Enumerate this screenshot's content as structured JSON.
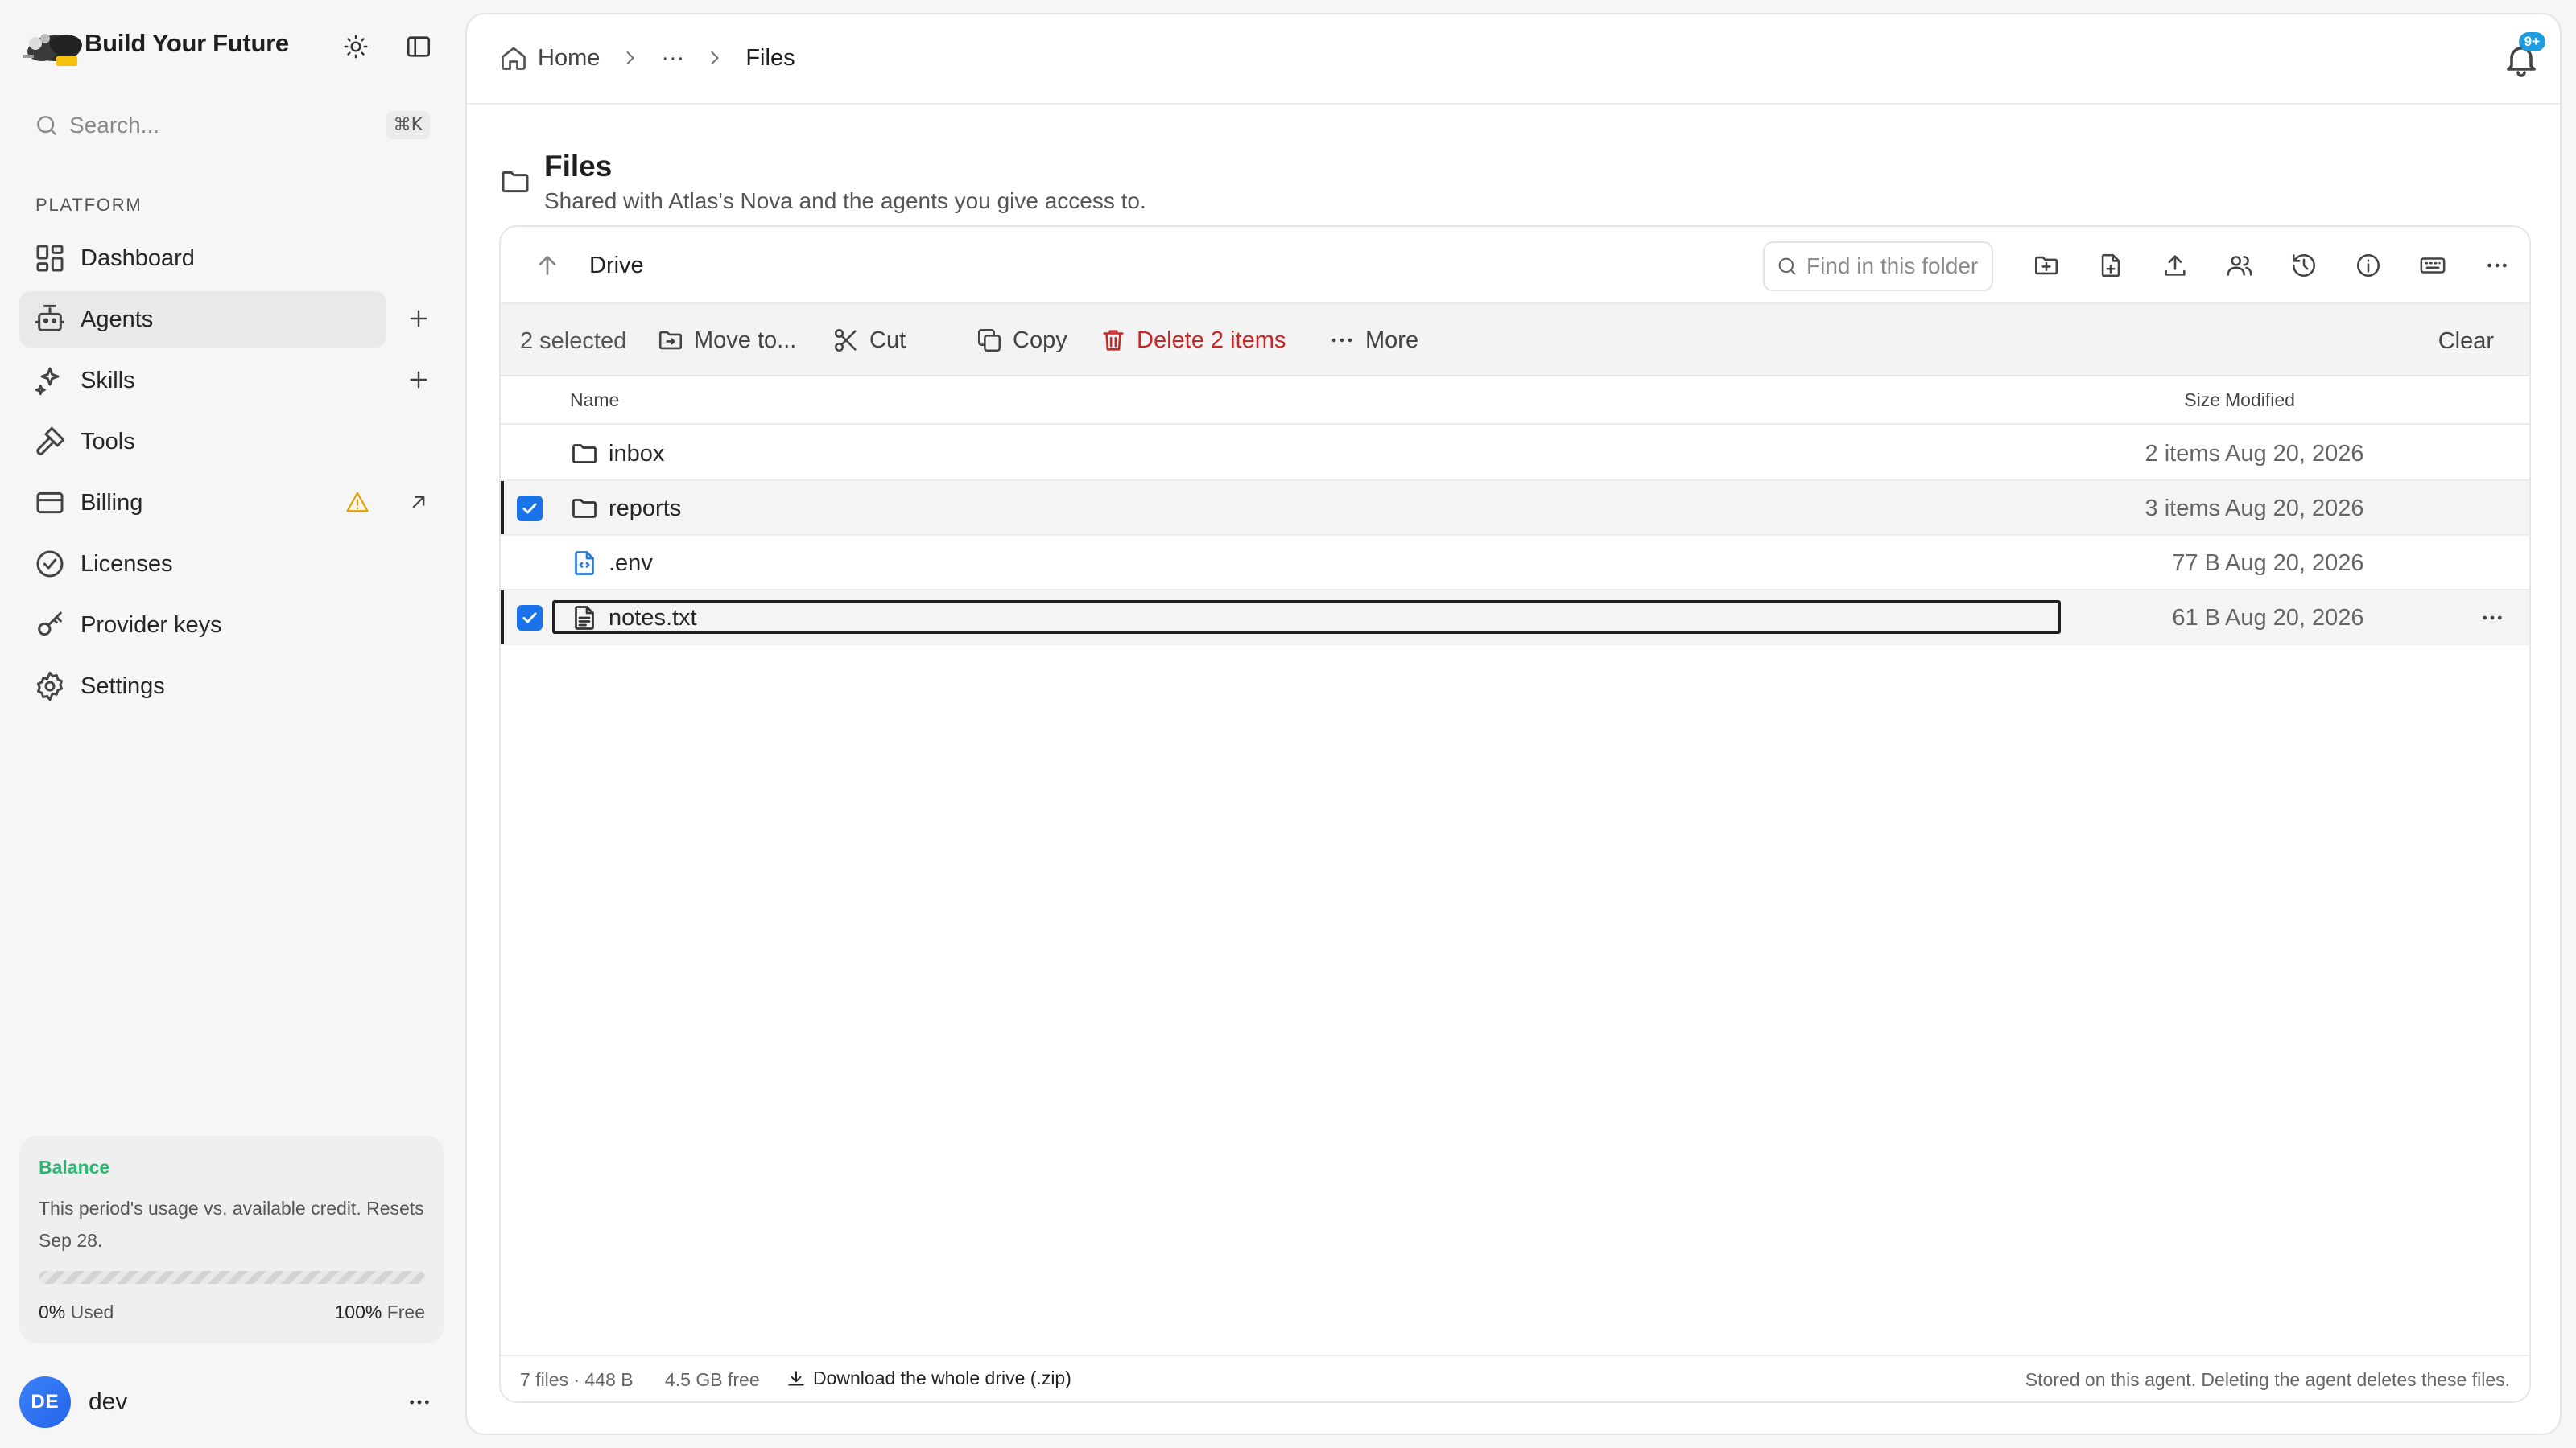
{
  "app": {
    "brand_name": "Build Your Future",
    "search_placeholder": "Search...",
    "search_shortcut": "⌘K"
  },
  "sidebar": {
    "section_label": "PLATFORM",
    "items": [
      {
        "label": "Dashboard",
        "icon": "dashboard-icon"
      },
      {
        "label": "Agents",
        "icon": "bot-icon",
        "active": true
      },
      {
        "label": "Skills",
        "icon": "sparkles-icon"
      },
      {
        "label": "Tools",
        "icon": "hammer-icon"
      },
      {
        "label": "Billing",
        "icon": "credit-card-icon"
      },
      {
        "label": "Licenses",
        "icon": "check-circle-icon"
      },
      {
        "label": "Provider keys",
        "icon": "key-icon"
      },
      {
        "label": "Settings",
        "icon": "gear-icon"
      }
    ],
    "balance": {
      "title": "Balance",
      "description": "This period's usage vs. available credit. Resets Sep 28.",
      "used_pct": "0%",
      "used_label": "Used",
      "free_pct": "100%",
      "free_label": "Free",
      "used_fraction": 0,
      "title_color": "#2bb673"
    },
    "user": {
      "initials": "DE",
      "name": "dev"
    }
  },
  "topbar": {
    "breadcrumbs": [
      "Home",
      "···",
      "Files"
    ],
    "notification_badge": "9+"
  },
  "page": {
    "title": "Files",
    "subtitle": "Shared with Atlas's Nova and the agents you give access to."
  },
  "browser": {
    "path_label": "Drive",
    "find_placeholder": "Find in this folder",
    "selection": {
      "count_label": "2 selected",
      "move_label": "Move to...",
      "cut_label": "Cut",
      "copy_label": "Copy",
      "delete_label": "Delete 2 items",
      "more_label": "More",
      "clear_label": "Clear",
      "delete_color": "#c62828"
    },
    "columns": {
      "name": "Name",
      "size": "Size",
      "modified": "Modified"
    },
    "rows": [
      {
        "name": "inbox",
        "type": "folder",
        "size": "2 items",
        "modified": "Aug 20, 2026",
        "selected": false
      },
      {
        "name": "reports",
        "type": "folder",
        "size": "3 items",
        "modified": "Aug 20, 2026",
        "selected": true
      },
      {
        "name": ".env",
        "type": "config-file",
        "size": "77 B",
        "modified": "Aug 20, 2026",
        "selected": false
      },
      {
        "name": "notes.txt",
        "type": "text-file",
        "size": "61 B",
        "modified": "Aug 20, 2026",
        "selected": true
      }
    ],
    "footer": {
      "stats": "7 files · 448 B",
      "free": "4.5 GB free",
      "download_label": "Download the whole drive (.zip)",
      "note": "Stored on this agent. Deleting the agent deletes these files."
    }
  }
}
